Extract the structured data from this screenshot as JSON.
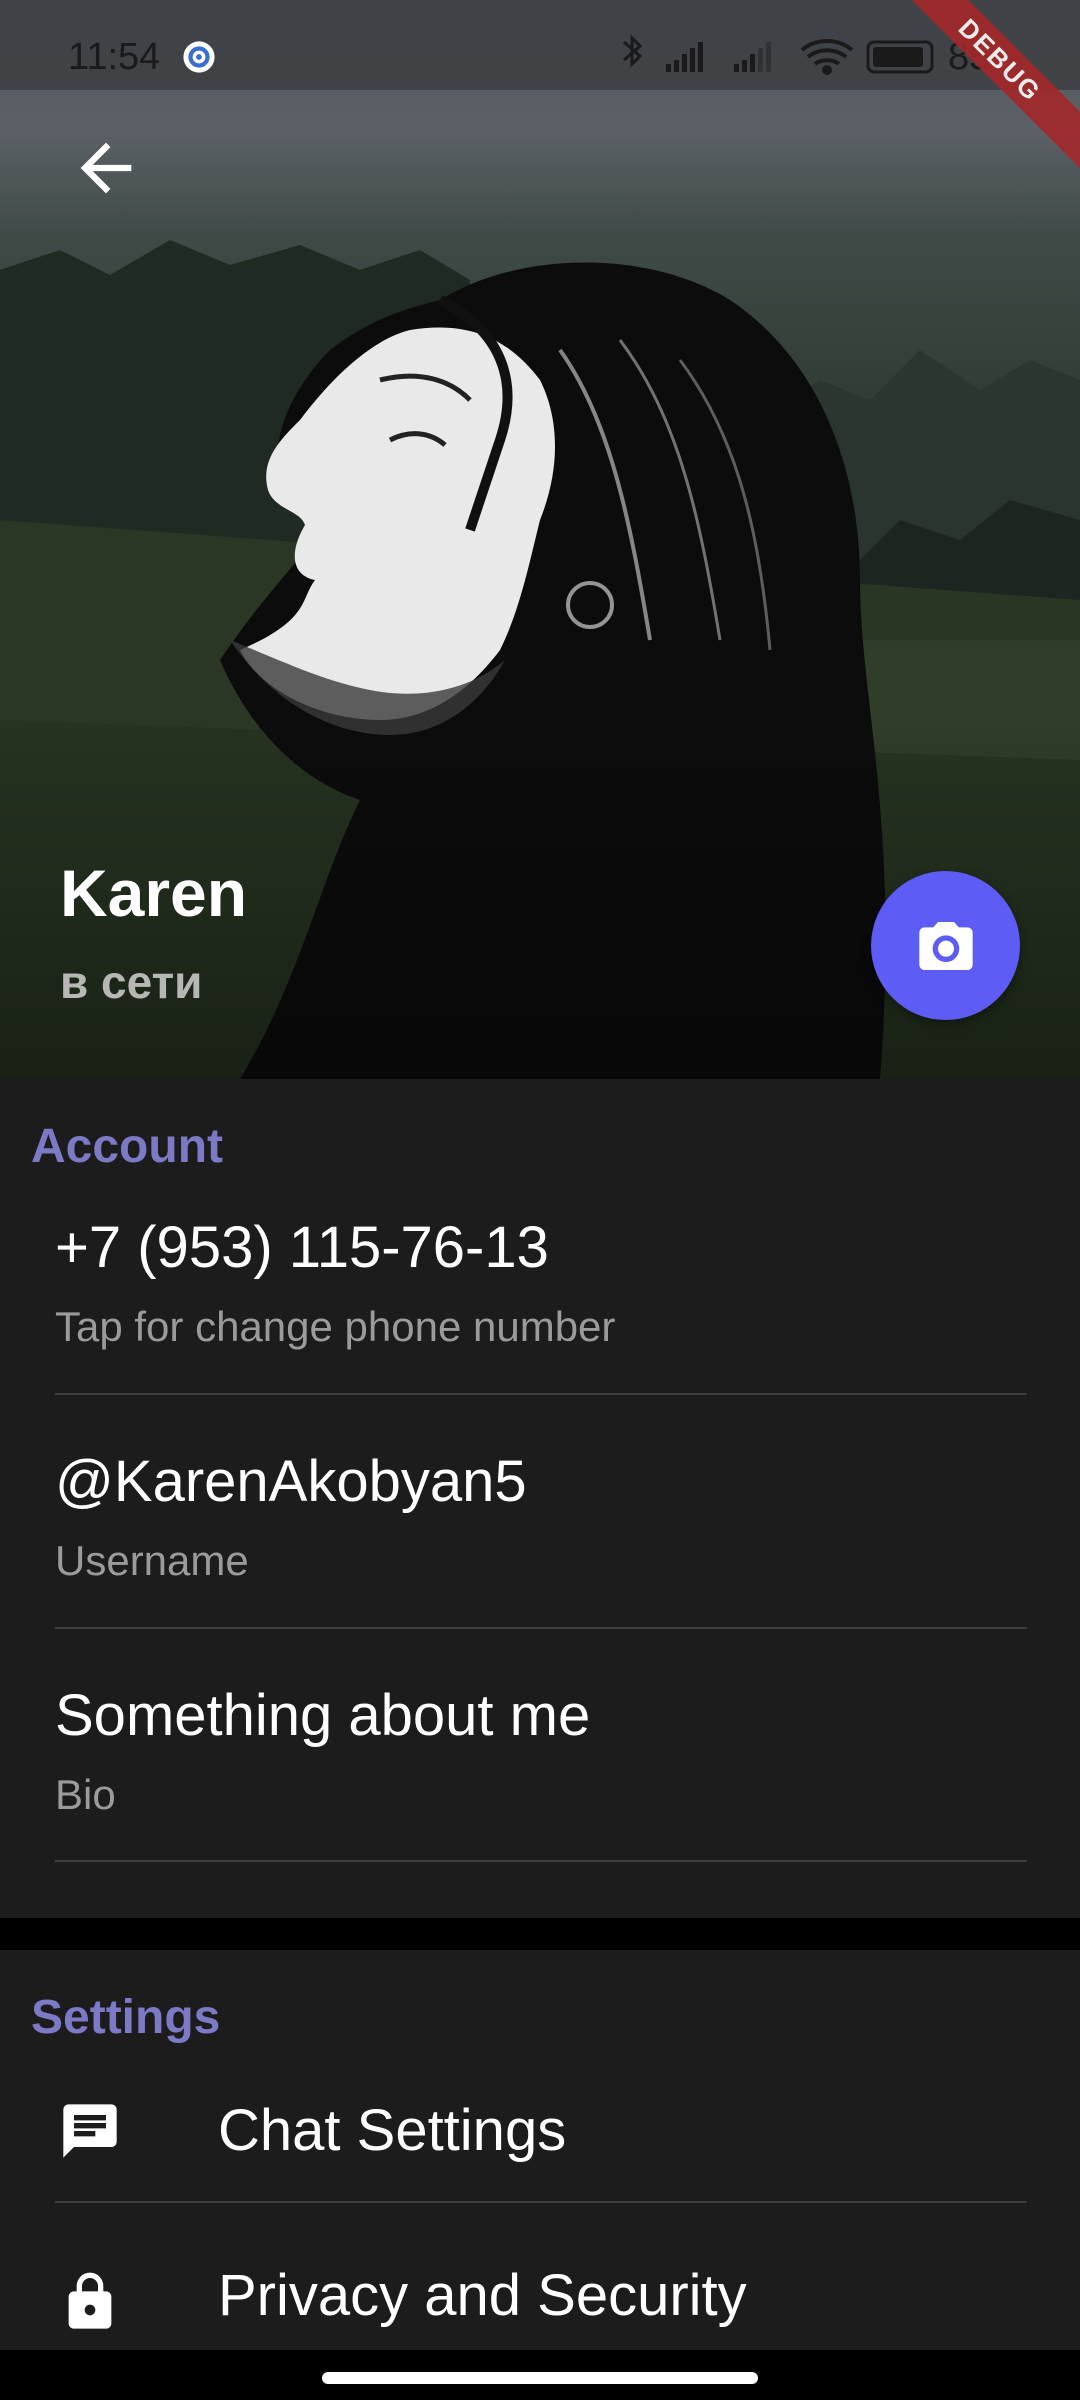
{
  "status_bar": {
    "time": "11:54",
    "battery_percent": "85",
    "icons": [
      "settings-gear-icon",
      "bluetooth-icon",
      "cell-signal-icon",
      "cell-signal-icon",
      "wifi-icon",
      "battery-icon"
    ]
  },
  "debug_banner": "DEBUG",
  "header": {
    "back_icon": "arrow-left-icon",
    "name": "Karen",
    "status": "в сети",
    "camera_icon": "camera-icon"
  },
  "account": {
    "title": "Account",
    "items": [
      {
        "value": "+7 (953) 115-76-13",
        "caption": "Tap for change phone number"
      },
      {
        "value": "@KarenAkobyan5",
        "caption": "Username"
      },
      {
        "value": "Something about me",
        "caption": "Bio"
      }
    ]
  },
  "settings": {
    "title": "Settings",
    "items": [
      {
        "label": "Chat Settings",
        "icon": "chat-icon"
      },
      {
        "label": "Privacy and Security",
        "icon": "lock-icon"
      }
    ]
  },
  "colors": {
    "accent": "#7c79c5",
    "fab": "#5d5cf5",
    "surface": "#1c1c1d",
    "debug_ribbon": "#a4282a"
  }
}
